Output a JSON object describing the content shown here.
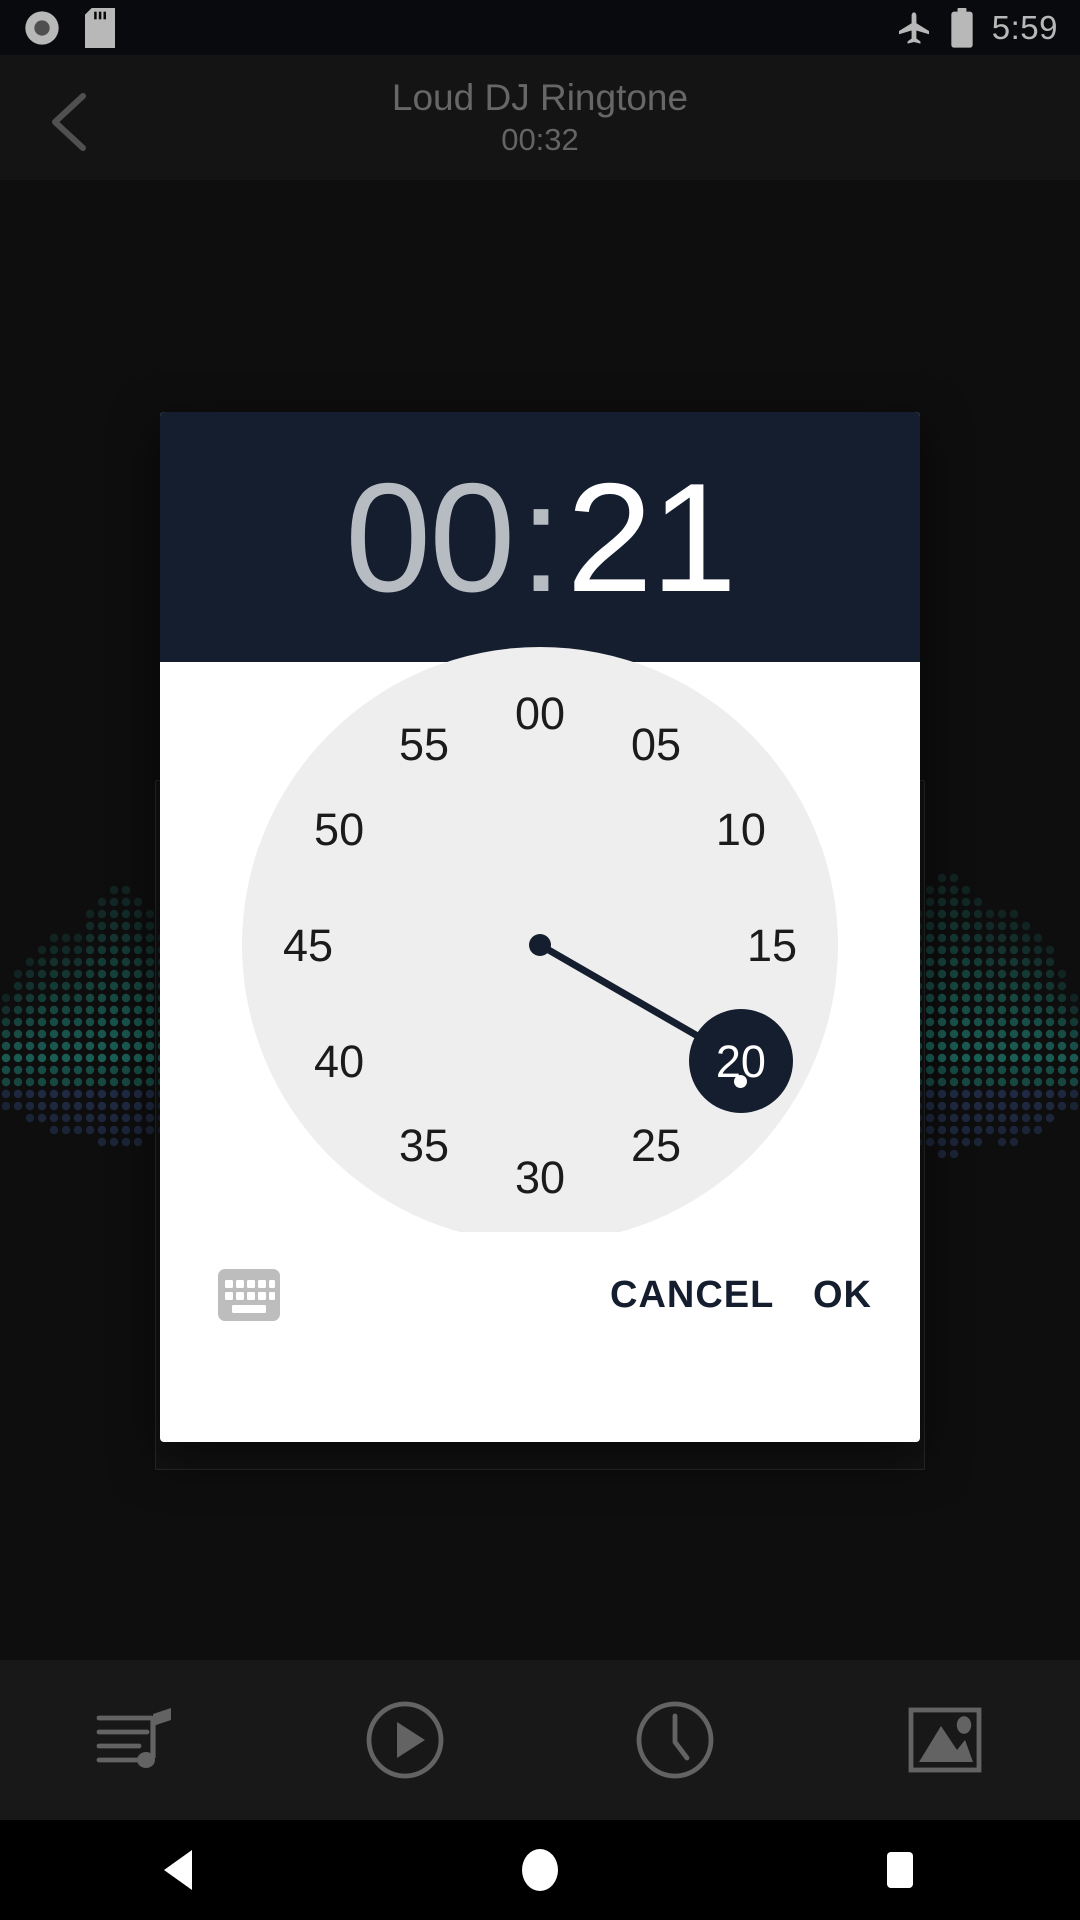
{
  "status_bar": {
    "time": "5:59",
    "icons": [
      "record-icon",
      "sd-card-icon",
      "airplane-mode-icon",
      "battery-icon"
    ]
  },
  "app_bar": {
    "back_icon": "chevron-left-icon",
    "title": "Loud DJ Ringtone",
    "duration": "00:32"
  },
  "dialog": {
    "header": {
      "minutes": "00",
      "separator": ":",
      "seconds": "21",
      "active_field": "seconds"
    },
    "clock": {
      "mode": "seconds",
      "selected_value": "20",
      "selected_angle_deg": 120,
      "tick_labels": [
        "00",
        "05",
        "10",
        "15",
        "20",
        "25",
        "30",
        "35",
        "40",
        "45",
        "50",
        "55"
      ]
    },
    "footer": {
      "keyboard_icon": "keyboard-icon",
      "cancel_label": "CANCEL",
      "ok_label": "OK"
    }
  },
  "toolbar": {
    "items": [
      {
        "name": "playlist-music-icon"
      },
      {
        "name": "play-circle-icon"
      },
      {
        "name": "clock-icon"
      },
      {
        "name": "image-icon"
      }
    ]
  },
  "nav_bar": {
    "back": "triangle-back-icon",
    "home": "circle-home-icon",
    "recents": "square-recents-icon"
  },
  "colors": {
    "accent": "#151e2e",
    "dialog_surface": "#ffffff",
    "clock_face": "#eeeeee",
    "app_background": "#141414",
    "status_bar": "#0d0f14",
    "waveform_teal": "#2a9d8f",
    "waveform_blue": "#3f5a99",
    "inactive_text": "#b7bcc2",
    "header_text": "#8f8f8f",
    "toolbar_icon": "#8a8a8a"
  }
}
